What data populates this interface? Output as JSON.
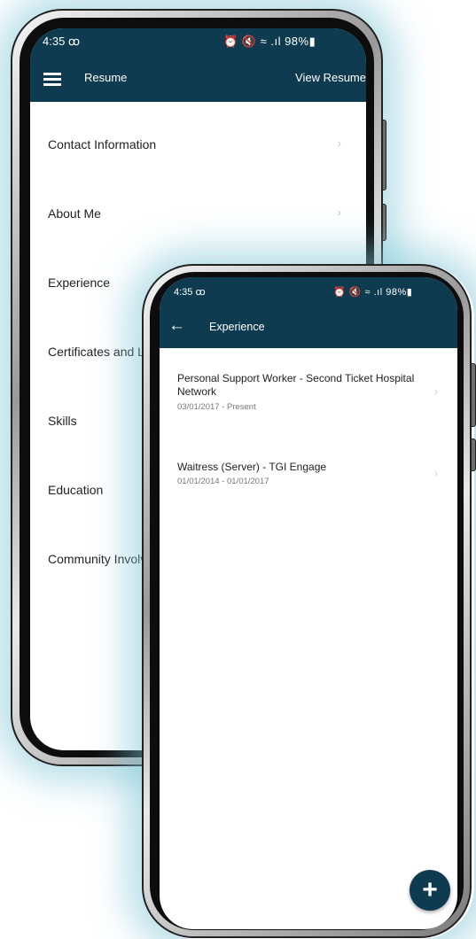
{
  "colors": {
    "primary": "#0e3b4f",
    "accent_glow": "#7dc4d6"
  },
  "back_phone": {
    "status": {
      "time": "4:35 ꝏ",
      "icons": "⏰ 🔇 ≈ .ıl 98%▮"
    },
    "appbar": {
      "menu_icon": "hamburger-icon",
      "title": "Resume",
      "action": "View Resume"
    },
    "menu": [
      {
        "label": "Contact Information"
      },
      {
        "label": "About Me"
      },
      {
        "label": "Experience"
      },
      {
        "label": "Certificates and Lic"
      },
      {
        "label": "Skills"
      },
      {
        "label": "Education"
      },
      {
        "label": "Community Involve"
      }
    ]
  },
  "front_phone": {
    "status": {
      "time": "4:35 ꝏ",
      "icons": "⏰ 🔇 ≈ .ıl 98%▮"
    },
    "appbar": {
      "back_icon": "arrow-left-icon",
      "title": "Experience"
    },
    "experiences": [
      {
        "title": "Personal Support Worker - Second Ticket Hospital Network",
        "dates": "03/01/2017 - Present"
      },
      {
        "title": "Waitress (Server) - TGI Engage",
        "dates": "01/01/2014 - 01/01/2017"
      }
    ],
    "fab": {
      "icon": "plus-icon",
      "label": "+"
    }
  }
}
